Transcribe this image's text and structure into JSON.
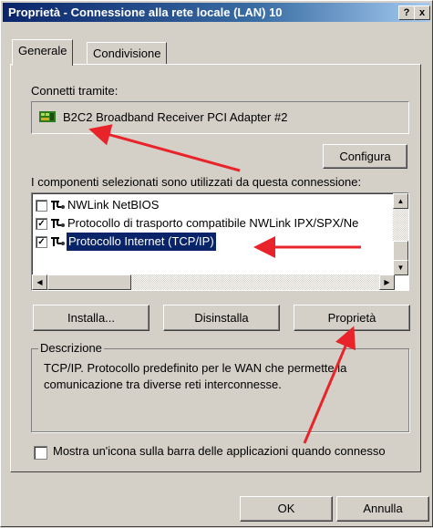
{
  "window": {
    "title": "Proprietà - Connessione alla rete locale (LAN) 10",
    "help_label": "?",
    "close_label": "x"
  },
  "tabs": [
    {
      "label": "Generale"
    },
    {
      "label": "Condivisione"
    }
  ],
  "connect_via": {
    "label": "Connetti tramite:",
    "adapter": "B2C2 Broadband Receiver PCI Adapter #2"
  },
  "configure_button": "Configura",
  "components": {
    "label": "I componenti selezionati sono utilizzati da questa connessione:",
    "items": [
      {
        "label": "NWLink NetBIOS",
        "checked": false
      },
      {
        "label": "Protocollo di trasporto compatibile NWLink IPX/SPX/Ne",
        "checked": true
      },
      {
        "label": "Protocollo Internet (TCP/IP)",
        "checked": true,
        "selected": true
      }
    ]
  },
  "buttons": {
    "install": "Installa...",
    "uninstall": "Disinstalla",
    "properties": "Proprietà"
  },
  "description": {
    "legend": "Descrizione",
    "text_line1": "TCP/IP. Protocollo predefinito per le WAN che permette la",
    "text_line2": "comunicazione tra diverse reti interconnesse."
  },
  "tray_icon": {
    "label": "Mostra un'icona sulla barra delle applicazioni quando connesso",
    "checked": false
  },
  "footer": {
    "ok": "OK",
    "cancel": "Annulla"
  },
  "colors": {
    "titlebar": "#0a246a",
    "selection": "#0a246a",
    "annotation_arrow": "#e8242a",
    "face": "#d4d0c8"
  }
}
